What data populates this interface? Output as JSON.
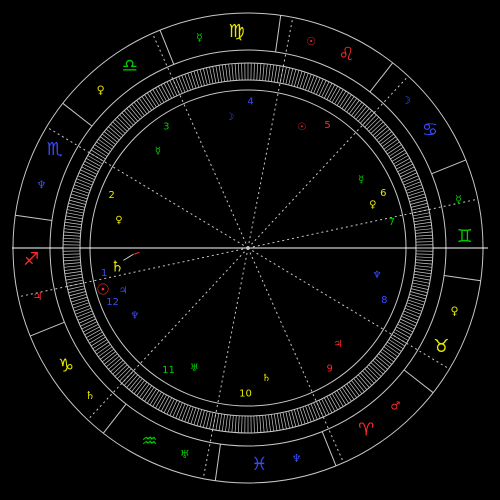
{
  "colors": {
    "background": "#000000",
    "line": "#c8c8c8",
    "axis": "#ffffff",
    "fire": "#ff2a2a",
    "earth": "#e8e800",
    "air": "#00cc00",
    "water": "#3b4bff"
  },
  "signs": [
    {
      "name": "aries",
      "glyph": "♈",
      "element": "fire",
      "ruler_glyph": "♂",
      "ruler_color": "fire"
    },
    {
      "name": "taurus",
      "glyph": "♉",
      "element": "earth",
      "ruler_glyph": "♀",
      "ruler_color": "earth"
    },
    {
      "name": "gemini",
      "glyph": "♊",
      "element": "air",
      "ruler_glyph": "☿",
      "ruler_color": "air"
    },
    {
      "name": "cancer",
      "glyph": "♋",
      "element": "water",
      "ruler_glyph": "☽",
      "ruler_color": "water"
    },
    {
      "name": "leo",
      "glyph": "♌",
      "element": "fire",
      "ruler_glyph": "☉",
      "ruler_color": "fire"
    },
    {
      "name": "virgo",
      "glyph": "♍",
      "element": "earth",
      "ruler_glyph": "☿",
      "ruler_color": "air"
    },
    {
      "name": "libra",
      "glyph": "♎",
      "element": "air",
      "ruler_glyph": "♀",
      "ruler_color": "earth"
    },
    {
      "name": "scorpio",
      "glyph": "♏",
      "element": "water",
      "ruler_glyph": "♆",
      "ruler_color": "water"
    },
    {
      "name": "sagittarius",
      "glyph": "♐",
      "element": "fire",
      "ruler_glyph": "♃",
      "ruler_color": "fire"
    },
    {
      "name": "capricorn",
      "glyph": "♑",
      "element": "earth",
      "ruler_glyph": "♄",
      "ruler_color": "earth"
    },
    {
      "name": "aquarius",
      "glyph": "♒",
      "element": "air",
      "ruler_glyph": "♅",
      "ruler_color": "air"
    },
    {
      "name": "pisces",
      "glyph": "♓",
      "element": "water",
      "ruler_glyph": "♆",
      "ruler_color": "water"
    }
  ],
  "houses": [
    {
      "number": "1",
      "element": "water",
      "ruler_glyph": "♃",
      "ruler_color": "water"
    },
    {
      "number": "2",
      "element": "earth",
      "ruler_glyph": "♀",
      "ruler_color": "earth"
    },
    {
      "number": "3",
      "element": "air",
      "ruler_glyph": "☿",
      "ruler_color": "air"
    },
    {
      "number": "4",
      "element": "water",
      "ruler_glyph": "☽",
      "ruler_color": "water"
    },
    {
      "number": "5",
      "element": "fire",
      "ruler_glyph": "☉",
      "ruler_color": "fire"
    },
    {
      "number": "6",
      "element": "earth",
      "ruler_glyph": "☿",
      "ruler_color": "air"
    },
    {
      "number": "7",
      "element": "air",
      "ruler_glyph": "♀",
      "ruler_color": "earth"
    },
    {
      "number": "8",
      "element": "water",
      "ruler_glyph": "♆",
      "ruler_color": "water"
    },
    {
      "number": "9",
      "element": "fire",
      "ruler_glyph": "♃",
      "ruler_color": "fire"
    },
    {
      "number": "10",
      "element": "earth",
      "ruler_glyph": "♄",
      "ruler_color": "earth"
    },
    {
      "number": "11",
      "element": "air",
      "ruler_glyph": "♅",
      "ruler_color": "air"
    },
    {
      "number": "12",
      "element": "water",
      "ruler_glyph": "♆",
      "ruler_color": "water"
    }
  ],
  "planets": [
    {
      "name": "sun",
      "glyph": "☉",
      "color": "fire"
    },
    {
      "name": "saturn",
      "glyph": "♄",
      "color": "earth"
    }
  ]
}
